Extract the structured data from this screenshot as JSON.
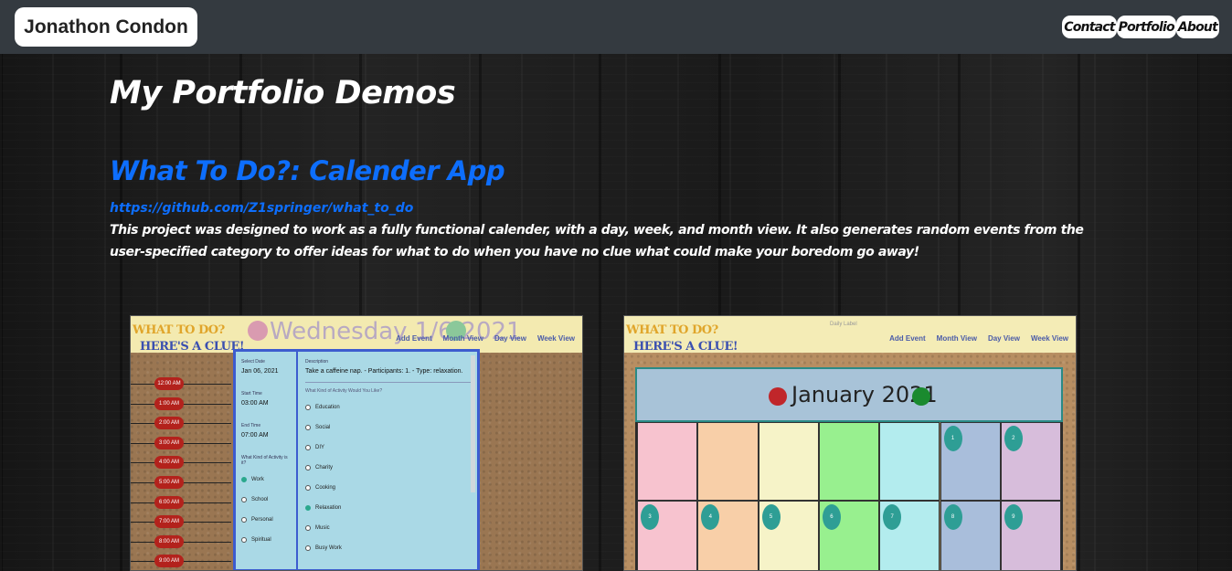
{
  "navbar": {
    "brand": "Jonathon Condon",
    "links": [
      {
        "label": "Contact"
      },
      {
        "label": "Portfolio"
      },
      {
        "label": "About"
      }
    ]
  },
  "page": {
    "title": "My Portfolio Demos"
  },
  "project": {
    "title": "What To Do?: Calender App",
    "link": "https://github.com/Z1springer/what_to_do",
    "description": "This project was designed to work as a fully functional calender, with a day, week, and month view. It also generates random events from the user-specified category to offer ideas for what to do when you have no clue what could make your boredom go away!"
  },
  "screenshot_day": {
    "logo_line1": "WHAT TO DO?",
    "logo_line2": "HERE'S A CLUE!",
    "date": "Wednesday 1/6/2021",
    "nav": [
      "Add Event",
      "Month View",
      "Day View",
      "Week View"
    ],
    "times": [
      "12:00 AM",
      "1:00 AM",
      "2:00 AM",
      "3:00 AM",
      "4:00 AM",
      "5:00 AM",
      "6:00 AM",
      "7:00 AM",
      "8:00 AM",
      "9:00 AM"
    ],
    "modal": {
      "select_date_label": "Select Date",
      "select_date_value": "Jan 06, 2021",
      "start_time_label": "Start Time",
      "start_time_value": "03:00 AM",
      "end_time_label": "End Time",
      "end_time_value": "07:00 AM",
      "kind_label": "What Kind of Activity is it?",
      "kinds": [
        "Work",
        "School",
        "Personal",
        "Spiritual"
      ],
      "description_label": "Description",
      "description_value": "Take a caffeine nap. - Participants: 1. - Type: relaxation.",
      "category_label": "What Kind of Activity Would You Like?",
      "categories": [
        "Education",
        "Social",
        "DIY",
        "Charity",
        "Cooking",
        "Relaxation",
        "Music",
        "Busy Work"
      ]
    }
  },
  "screenshot_month": {
    "logo_line1": "WHAT TO DO?",
    "logo_line2": "HERE'S A CLUE!",
    "nav": [
      "Add Event",
      "Month View",
      "Day View",
      "Week View"
    ],
    "header_small": "Daily Label",
    "month": "January 2021",
    "days_row1": [
      "1",
      "2"
    ],
    "days_row2": [
      "3",
      "4",
      "5",
      "6",
      "7",
      "8",
      "9"
    ],
    "colors": [
      "#f7c3cf",
      "#f8cfa8",
      "#f6f3c8",
      "#98f08f",
      "#b3ecee",
      "#a9bedb",
      "#d7bddb"
    ]
  }
}
